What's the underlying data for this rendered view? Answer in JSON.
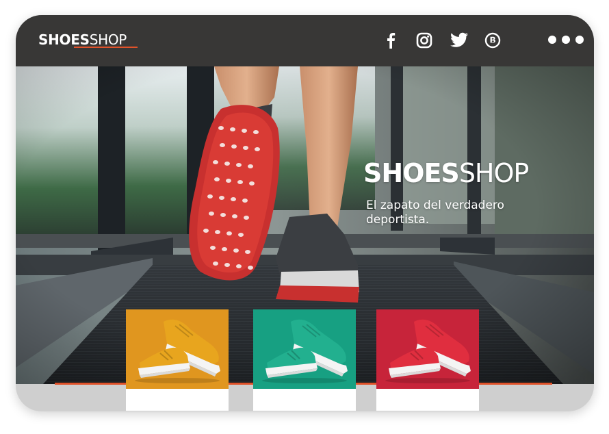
{
  "brand": {
    "bold": "SHOES",
    "light": "SHOP"
  },
  "social_icons": [
    "facebook-icon",
    "instagram-icon",
    "twitter-icon",
    "behance-icon"
  ],
  "menu_icon": "more-dots-icon",
  "hero": {
    "title_bold": "SHOES",
    "title_light": "SHOP",
    "tagline": "El zapato del verdadero deportista."
  },
  "products": [
    {
      "color_name": "orange",
      "bg": "#e0961f",
      "shoe": "#e8a51e"
    },
    {
      "color_name": "teal",
      "bg": "#17a082",
      "shoe": "#22b08f"
    },
    {
      "color_name": "red",
      "bg": "#c7243a",
      "shoe": "#e02e3f"
    }
  ],
  "colors": {
    "topbar": "#383736",
    "accent": "#e0522a",
    "sole": "#c8302f"
  }
}
